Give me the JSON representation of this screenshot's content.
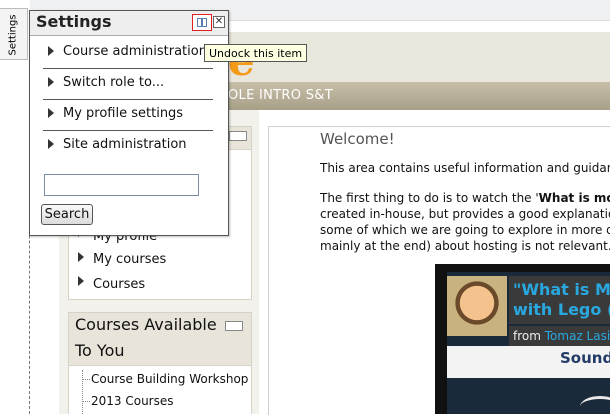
{
  "dock": {
    "tab_label": "Settings"
  },
  "header": {
    "logo_fragment": "e",
    "course_name": "OLE INTRO S&T"
  },
  "nav_block": {
    "items": [
      "My profile",
      "My courses",
      "Courses"
    ]
  },
  "courses_block": {
    "title": "Courses Available To You",
    "items": [
      "Course Building Workshop",
      "2013 Courses"
    ]
  },
  "main": {
    "welcome": "Welcome!",
    "intro": "This area contains useful information and guidance",
    "para_prefix": "The first thing to do is to watch the '",
    "para_bold": "What is mooc",
    "line2": "created in-house, but provides a good explanation",
    "line3": "some of which we are going to explore in more det",
    "line4": "mainly at the end) about hosting is not relevant."
  },
  "video": {
    "title_line1": "\"What is Mo",
    "title_line2": "with Lego (",
    "from_label": "from",
    "author": "Tomaz Lasi",
    "band_text": "Sounds"
  },
  "settings": {
    "title": "Settings",
    "close_glyph": "✕",
    "items": [
      "Course administration",
      "Switch role to...",
      "My profile settings",
      "Site administration"
    ],
    "search_value": "",
    "search_button": "Search"
  },
  "tooltip": {
    "text": "Undock this item"
  },
  "colors": {
    "accent_orange": "#f39a16",
    "link_blue": "#29a8e0",
    "undock_highlight": "#e02020"
  }
}
